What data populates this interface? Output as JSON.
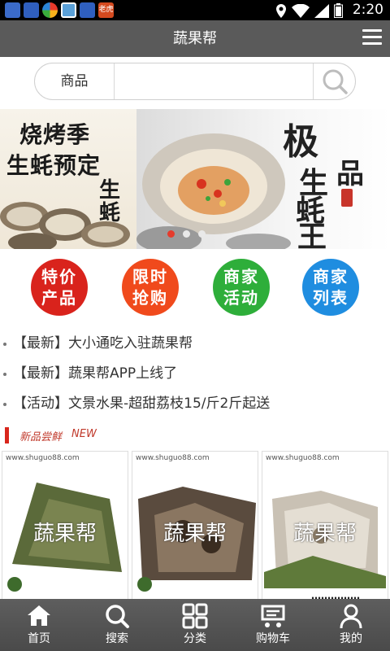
{
  "status_bar": {
    "time": "2:20",
    "notification_icons": [
      "paw-icon",
      "paw-icon",
      "fruit-app-icon",
      "photo-icon",
      "paw-icon",
      "news-app-icon"
    ],
    "news_badge": "老虎"
  },
  "header": {
    "title": "蔬果帮"
  },
  "search": {
    "category": "商品",
    "placeholder": ""
  },
  "banner": {
    "left_line_1": "烧烤季",
    "left_line_2": "生蚝预定",
    "left_line_3": "生蚝",
    "right_char_1": "极",
    "right_char_2": "品",
    "right_char_3": "生",
    "right_char_4": "蚝",
    "right_char_5": "王",
    "slide_count": 3,
    "active_slide": 1
  },
  "categories": [
    {
      "line1": "特价",
      "line2": "产品",
      "color": "#d9231c"
    },
    {
      "line1": "限时",
      "line2": "抢购",
      "color": "#f04a1c"
    },
    {
      "line1": "商家",
      "line2": "活动",
      "color": "#2eae3a"
    },
    {
      "line1": "商家",
      "line2": "列表",
      "color": "#1f8de0"
    }
  ],
  "news": [
    "【最新】大小通吃入驻蔬果帮",
    "【最新】蔬果帮APP上线了",
    "【活动】文景水果-超甜荔枝15/斤2斤起送"
  ],
  "section": {
    "title": "新品尝鲜",
    "badge": "NEW"
  },
  "products": [
    {
      "site": "www.shuguo88.com",
      "watermark": "蔬果帮",
      "caption": ""
    },
    {
      "site": "www.shuguo88.com",
      "watermark": "蔬果帮",
      "caption": ""
    },
    {
      "site": "www.shuguo88.com",
      "watermark": "蔬果帮",
      "caption": "……………"
    }
  ],
  "bottom_nav": [
    {
      "label": "首页",
      "icon": "home-icon"
    },
    {
      "label": "搜索",
      "icon": "search-icon"
    },
    {
      "label": "分类",
      "icon": "grid-icon"
    },
    {
      "label": "购物车",
      "icon": "cart-icon"
    },
    {
      "label": "我的",
      "icon": "user-icon"
    }
  ],
  "colors": {
    "header_bg": "#5a5a5a",
    "accent_red": "#d8261c",
    "nav_bg": "#525252"
  }
}
